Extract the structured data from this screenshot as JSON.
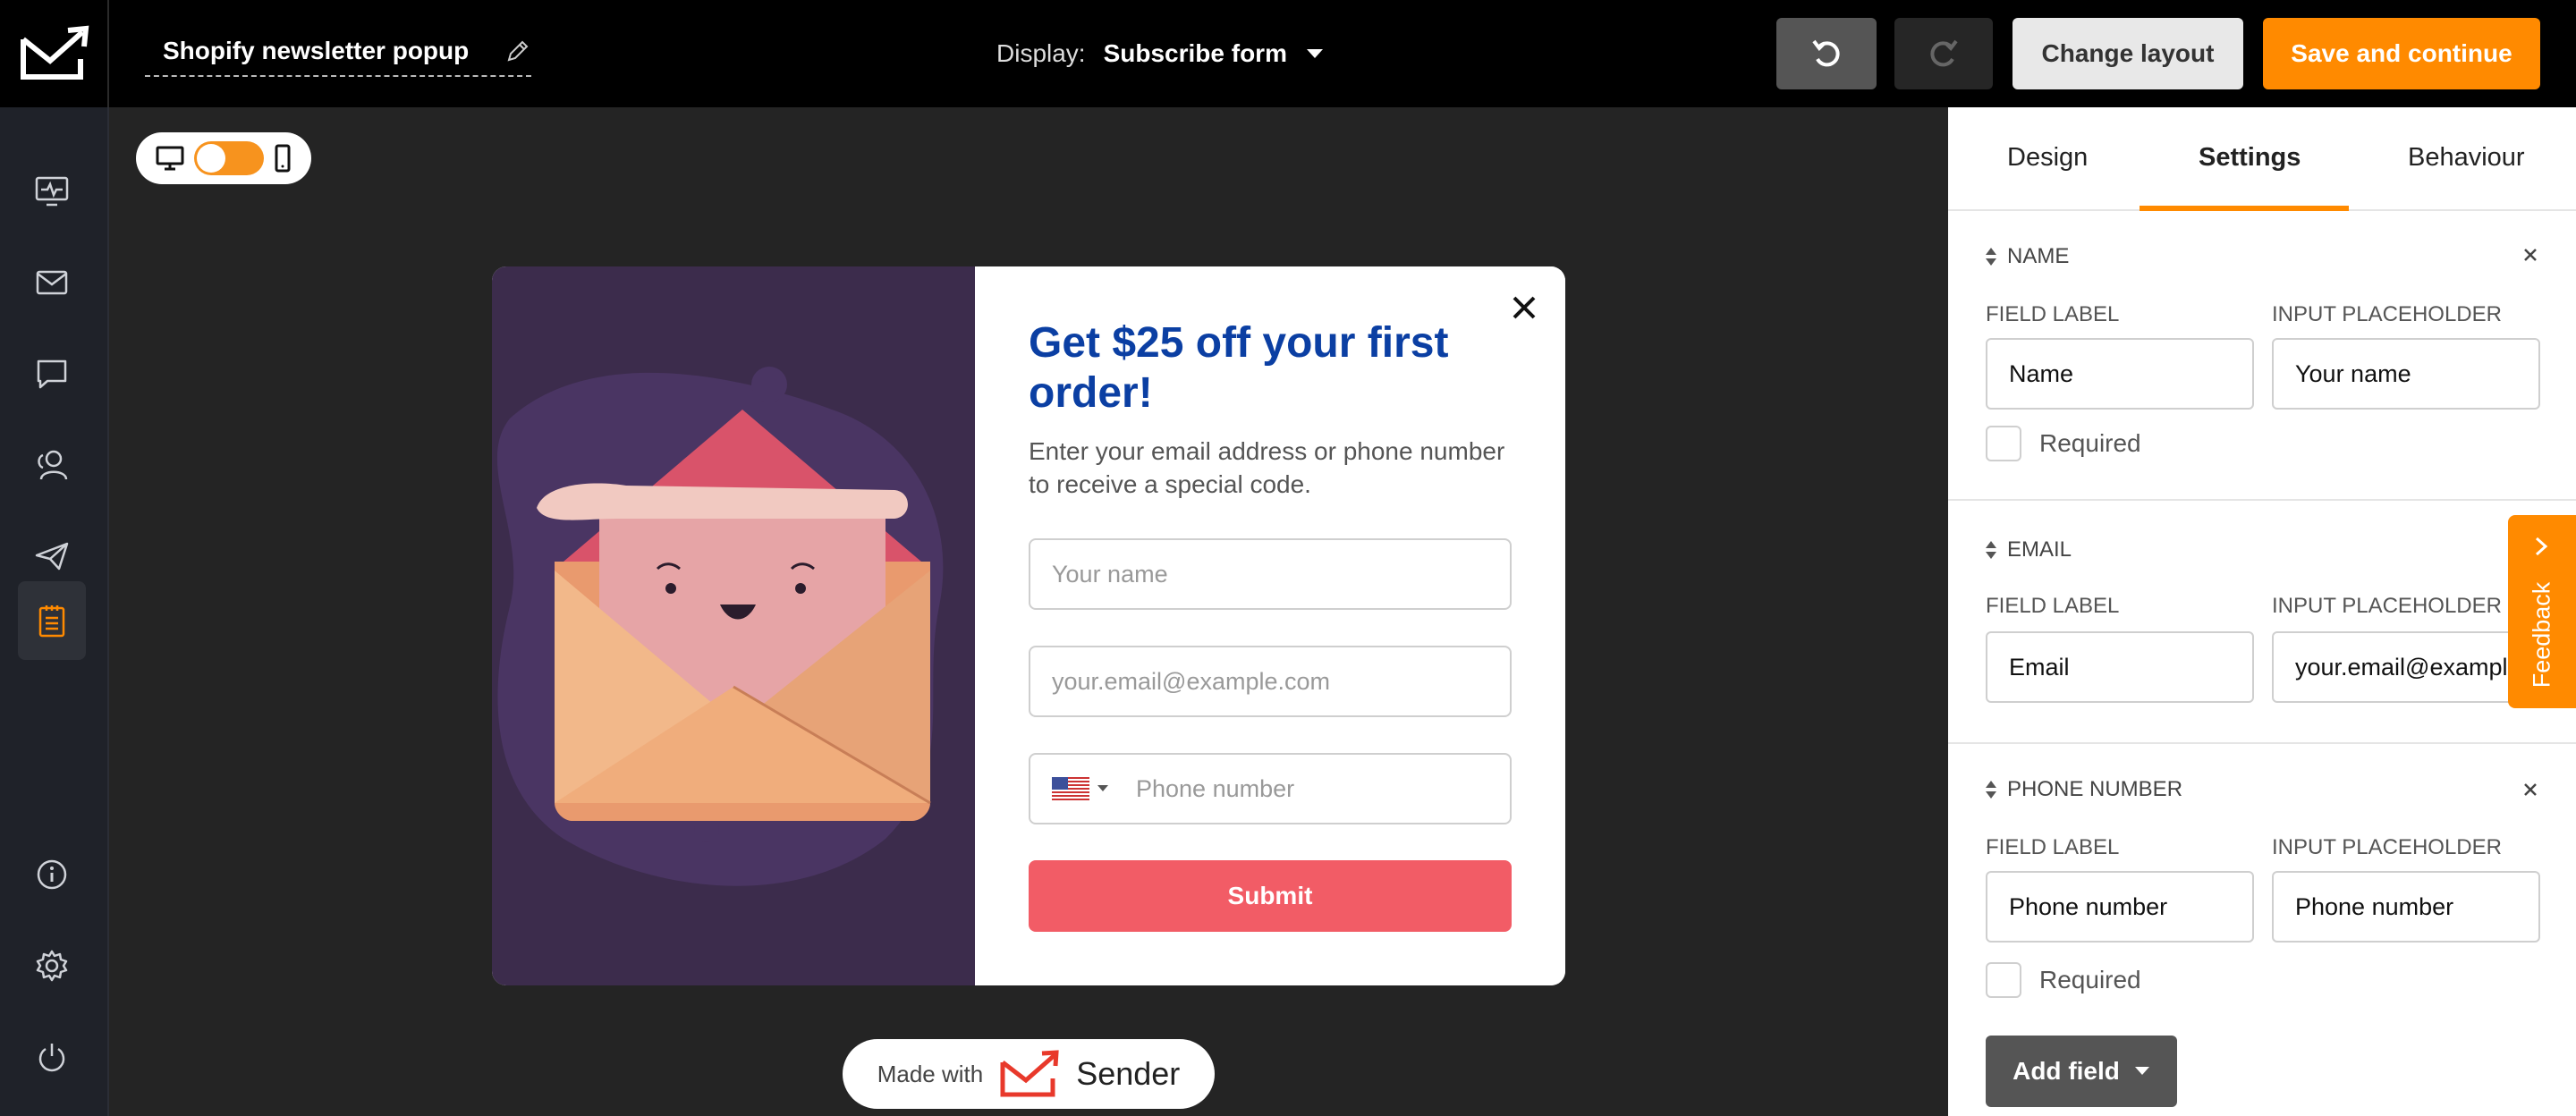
{
  "header": {
    "title": "Shopify newsletter popup",
    "display_label": "Display:",
    "display_value": "Subscribe form",
    "change_layout": "Change layout",
    "save_continue": "Save and continue"
  },
  "sidebar": {
    "items": [
      {
        "name": "dashboard"
      },
      {
        "name": "campaigns"
      },
      {
        "name": "chat"
      },
      {
        "name": "subscribers"
      },
      {
        "name": "automation"
      },
      {
        "name": "forms",
        "active": true
      },
      {
        "name": "info"
      },
      {
        "name": "settings"
      },
      {
        "name": "logout"
      }
    ]
  },
  "popup": {
    "heading": "Get $25 off your first order!",
    "subtext": "Enter your email address or phone number to receive a special code.",
    "name_placeholder": "Your name",
    "email_placeholder": "your.email@example.com",
    "phone_placeholder": "Phone number",
    "submit": "Submit"
  },
  "footer_badge": {
    "made_with": "Made with",
    "brand": "Sender"
  },
  "panel": {
    "tabs": [
      "Design",
      "Settings",
      "Behaviour"
    ],
    "active_tab": "Settings",
    "field_label_caption": "FIELD LABEL",
    "placeholder_caption": "INPUT PLACEHOLDER",
    "required_label": "Required",
    "fields": [
      {
        "title": "NAME",
        "label": "Name",
        "placeholder": "Your name",
        "required": false
      },
      {
        "title": "EMAIL",
        "label": "Email",
        "placeholder": "your.email@example.com"
      },
      {
        "title": "PHONE NUMBER",
        "label": "Phone number",
        "placeholder": "Phone number",
        "required": false
      }
    ],
    "add_field": "Add field"
  },
  "feedback": "Feedback",
  "colors": {
    "accent": "#ff8a00",
    "heading_blue": "#0b3fa3",
    "submit_red": "#f25c66",
    "sidebar": "#1f2229",
    "canvas": "#242424"
  }
}
